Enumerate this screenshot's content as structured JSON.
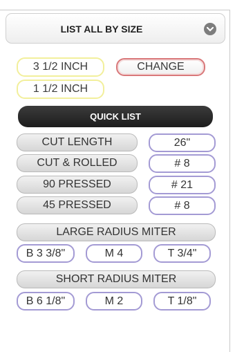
{
  "header": {
    "title": "LIST ALL BY SIZE",
    "icon": "chevron-down-icon"
  },
  "sizes": {
    "size_a": "3 1/2 INCH",
    "size_b": "1 1/2 INCH"
  },
  "change_label": "CHANGE",
  "quick_list_label": "QUICK LIST",
  "rows": [
    {
      "label": "CUT LENGTH",
      "value": "26\""
    },
    {
      "label": "CUT & ROLLED",
      "value": "# 8"
    },
    {
      "label": "90 PRESSED",
      "value": "# 21"
    },
    {
      "label": "45 PRESSED",
      "value": "# 8"
    }
  ],
  "large_radius": {
    "label": "LARGE RADIUS MITER",
    "b": "B 3 3/8\"",
    "m": "M 4",
    "t": "T 3/4\""
  },
  "short_radius": {
    "label": "SHORT RADIUS MITER",
    "b": "B 6 1/8\"",
    "m": "M 2",
    "t": "T 1/8\""
  },
  "colors": {
    "accent_purple": "#a39ad4",
    "accent_red": "#d9787a",
    "accent_yellow": "#f2ef9b"
  }
}
